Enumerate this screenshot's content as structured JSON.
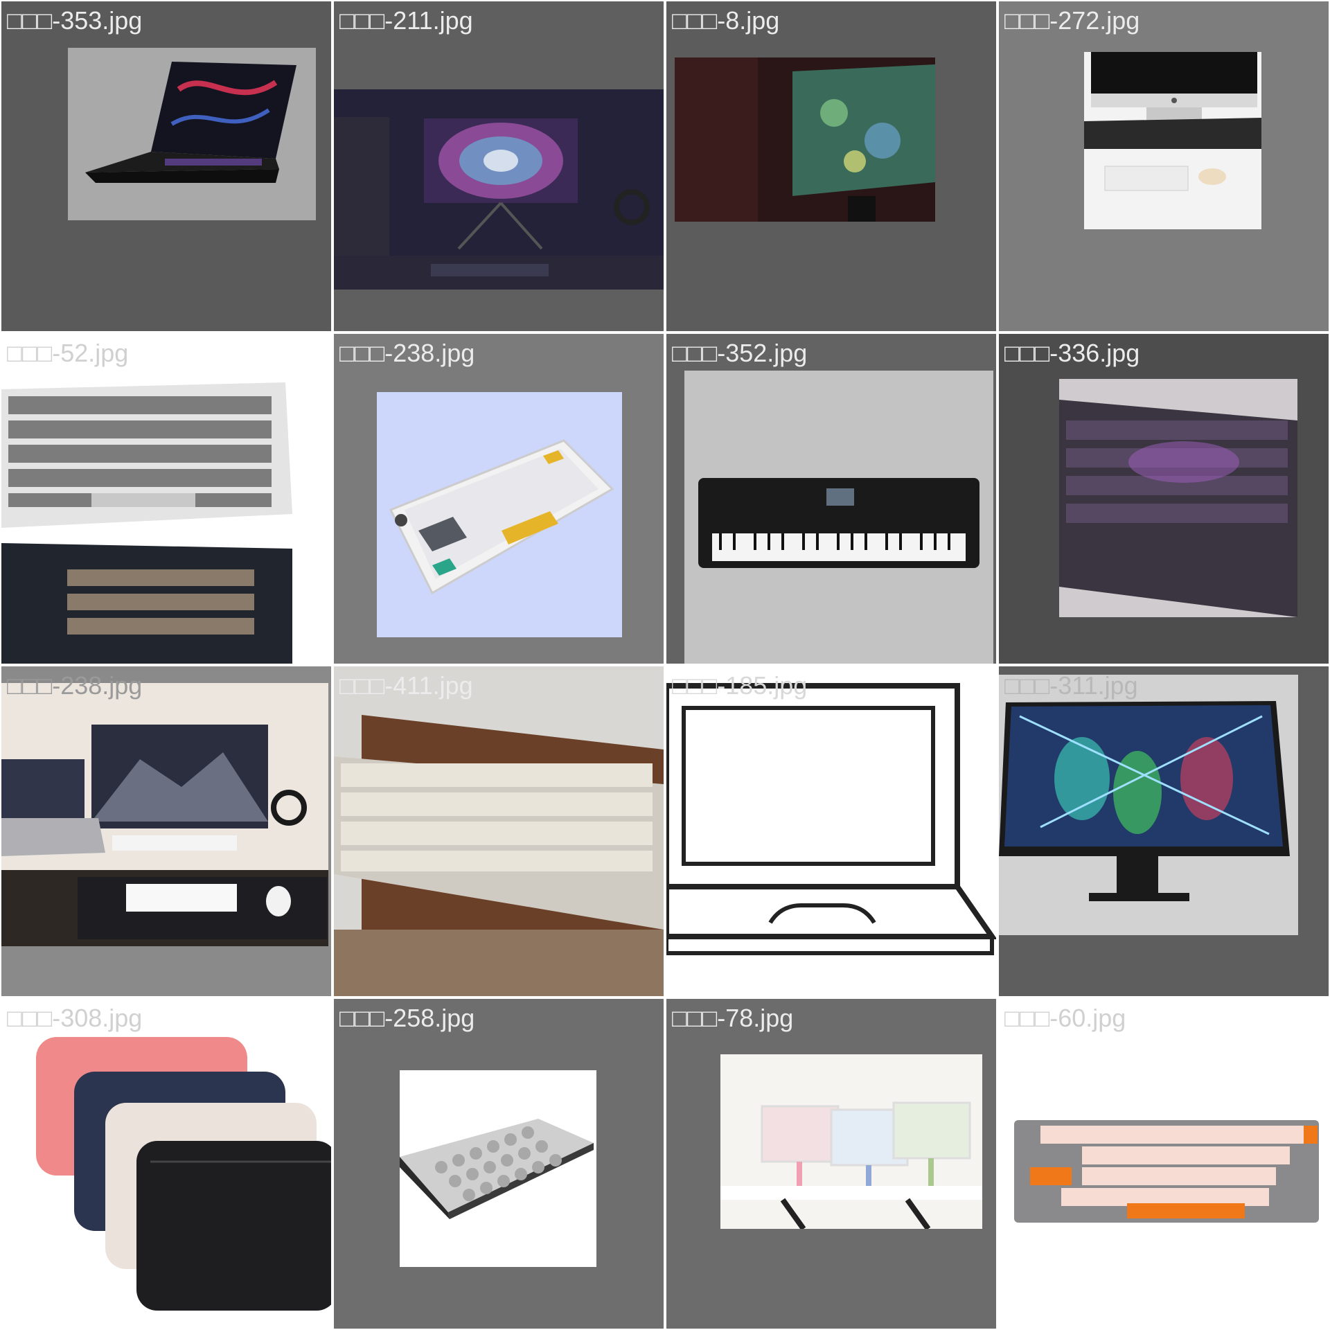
{
  "caption_prefix_glyphs": "□□□",
  "tiles": [
    {
      "name": "-353.jpg",
      "tile_bg": "#5a5a5a",
      "caption_color": "#ececec"
    },
    {
      "name": "-211.jpg",
      "tile_bg": "#5f5f5f",
      "caption_color": "#ececec"
    },
    {
      "name": "-8.jpg",
      "tile_bg": "#5c5c5c",
      "caption_color": "#ececec"
    },
    {
      "name": "-272.jpg",
      "tile_bg": "#7d7d7d",
      "caption_color": "#ececec"
    },
    {
      "name": "-52.jpg",
      "tile_bg": "#ffffff",
      "caption_color": "#d0d0d0"
    },
    {
      "name": "-238.jpg",
      "tile_bg": "#7b7b7b",
      "caption_color": "#ececec"
    },
    {
      "name": "-352.jpg",
      "tile_bg": "#636363",
      "caption_color": "#ececec"
    },
    {
      "name": "-336.jpg",
      "tile_bg": "#4d4d4d",
      "caption_color": "#ececec"
    },
    {
      "name": "-238.jpg",
      "tile_bg": "#8a8a8a",
      "caption_color": "#9a9a9a"
    },
    {
      "name": "-411.jpg",
      "tile_bg": "#d9d7d4",
      "caption_color": "#ececec"
    },
    {
      "name": "-185.jpg",
      "tile_bg": "#ffffff",
      "caption_color": "#d8d8d8"
    },
    {
      "name": "-311.jpg",
      "tile_bg": "#5e5e5e",
      "caption_color": "#b8b8b8"
    },
    {
      "name": "-308.jpg",
      "tile_bg": "#ffffff",
      "caption_color": "#d0d0d0"
    },
    {
      "name": "-258.jpg",
      "tile_bg": "#6e6e6e",
      "caption_color": "#ececec"
    },
    {
      "name": "-78.jpg",
      "tile_bg": "#6c6c6c",
      "caption_color": "#ececec"
    },
    {
      "name": "-60.jpg",
      "tile_bg": "#ffffff",
      "caption_color": "#d0d0d0"
    }
  ]
}
